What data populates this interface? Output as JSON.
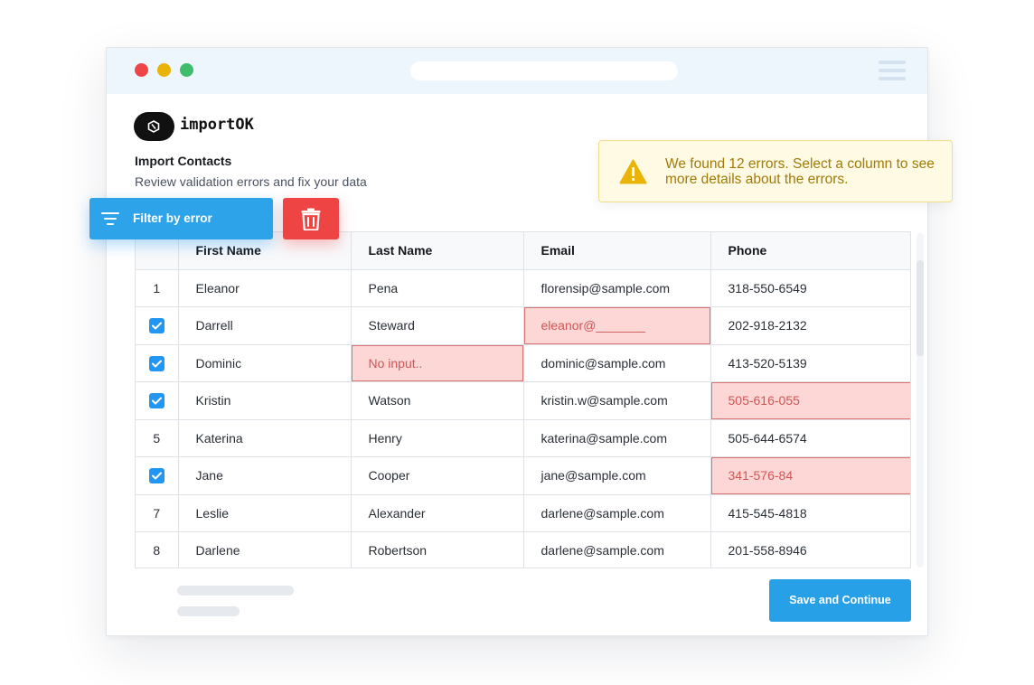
{
  "app": {
    "logo_text": "importOK"
  },
  "page": {
    "title": "Import Contacts",
    "subtitle": "Review validation errors and fix your data"
  },
  "alert": {
    "message": "We found 12 errors. Select a column to see more details about the errors.",
    "icon": "warning-icon",
    "color": "#a17a08"
  },
  "toolbar": {
    "filter_label": "Filter by error",
    "delete_icon": "trash-icon"
  },
  "table": {
    "columns": [
      "",
      "First Name",
      "Last Name",
      "Email",
      "Phone"
    ],
    "rows": [
      {
        "marker": "1",
        "checked": false,
        "first": "Eleanor",
        "last": "Pena",
        "email": "florensip@sample.com",
        "phone": "318-550-6549",
        "errors": []
      },
      {
        "marker": "",
        "checked": true,
        "first": "Darrell",
        "last": "Steward",
        "email": "eleanor@_______",
        "phone": "202-918-2132",
        "errors": [
          "email"
        ]
      },
      {
        "marker": "",
        "checked": true,
        "first": "Dominic",
        "last": "No input..",
        "email": "dominic@sample.com",
        "phone": "413-520-5139",
        "errors": [
          "last"
        ]
      },
      {
        "marker": "",
        "checked": true,
        "first": "Kristin",
        "last": "Watson",
        "email": "kristin.w@sample.com",
        "phone": "505-616-055",
        "errors": [
          "phone"
        ]
      },
      {
        "marker": "5",
        "checked": false,
        "first": "Katerina",
        "last": "Henry",
        "email": "katerina@sample.com",
        "phone": "505-644-6574",
        "errors": []
      },
      {
        "marker": "",
        "checked": true,
        "first": "Jane",
        "last": "Cooper",
        "email": "jane@sample.com",
        "phone": "341-576-84",
        "errors": [
          "phone"
        ]
      },
      {
        "marker": "7",
        "checked": false,
        "first": "Leslie",
        "last": "Alexander",
        "email": "darlene@sample.com",
        "phone": "415-545-4818",
        "errors": []
      },
      {
        "marker": "8",
        "checked": false,
        "first": "Darlene",
        "last": "Robertson",
        "email": "darlene@sample.com",
        "phone": "201-558-8946",
        "errors": []
      }
    ]
  },
  "footer": {
    "save_label": "Save and Continue"
  },
  "colors": {
    "accent": "#27a0e8",
    "danger": "#ef4444",
    "error_bg": "#fdd6d6",
    "warning_bg": "#fefae4"
  }
}
